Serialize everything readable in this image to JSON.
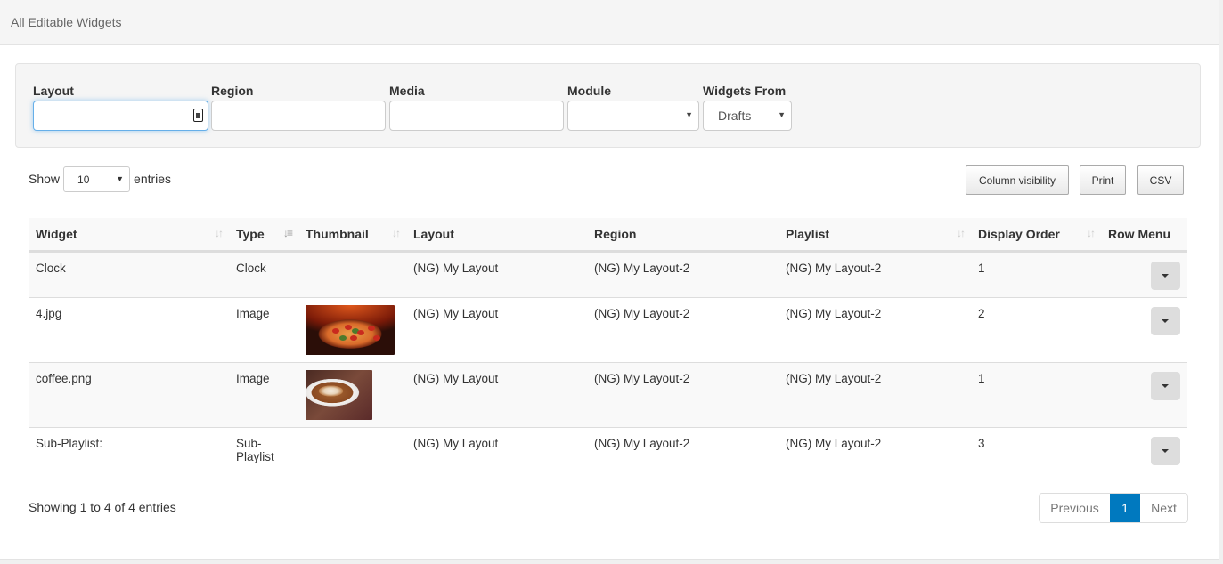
{
  "header": {
    "title": "All Editable Widgets"
  },
  "filters": {
    "layout": {
      "label": "Layout",
      "value": ""
    },
    "region": {
      "label": "Region",
      "value": ""
    },
    "media": {
      "label": "Media",
      "value": ""
    },
    "module": {
      "label": "Module",
      "value": ""
    },
    "widgets_from": {
      "label": "Widgets From",
      "value": "Drafts"
    }
  },
  "length_menu": {
    "prefix": "Show",
    "value": "10",
    "suffix": "entries"
  },
  "buttons": {
    "column_visibility": "Column visibility",
    "print": "Print",
    "csv": "CSV"
  },
  "table": {
    "columns": [
      {
        "label": "Widget",
        "sortable": true,
        "sort": "none"
      },
      {
        "label": "Type",
        "sortable": true,
        "sort": "asc"
      },
      {
        "label": "Thumbnail",
        "sortable": true,
        "sort": "none"
      },
      {
        "label": "Layout",
        "sortable": false
      },
      {
        "label": "Region",
        "sortable": false
      },
      {
        "label": "Playlist",
        "sortable": true,
        "sort": "none"
      },
      {
        "label": "Display Order",
        "sortable": true,
        "sort": "none"
      },
      {
        "label": "Row Menu",
        "sortable": false
      }
    ],
    "rows": [
      {
        "widget": "Clock",
        "type": "Clock",
        "thumbnail": "",
        "layout": "(NG) My Layout",
        "region": "(NG) My Layout-2",
        "playlist": "(NG) My Layout-2",
        "display_order": "1"
      },
      {
        "widget": "4.jpg",
        "type": "Image",
        "thumbnail": "pizza-image",
        "layout": "(NG) My Layout",
        "region": "(NG) My Layout-2",
        "playlist": "(NG) My Layout-2",
        "display_order": "2"
      },
      {
        "widget": "coffee.png",
        "type": "Image",
        "thumbnail": "coffee-image",
        "layout": "(NG) My Layout",
        "region": "(NG) My Layout-2",
        "playlist": "(NG) My Layout-2",
        "display_order": "1"
      },
      {
        "widget": "Sub-Playlist:",
        "type": "Sub-Playlist",
        "thumbnail": "",
        "layout": "(NG) My Layout",
        "region": "(NG) My Layout-2",
        "playlist": "(NG) My Layout-2",
        "display_order": "3"
      }
    ]
  },
  "footer": {
    "info": "Showing 1 to 4 of 4 entries",
    "pagination": {
      "previous": "Previous",
      "current": "1",
      "next": "Next"
    }
  },
  "colors": {
    "accent": "#0079bf",
    "focus": "#66afe9"
  }
}
